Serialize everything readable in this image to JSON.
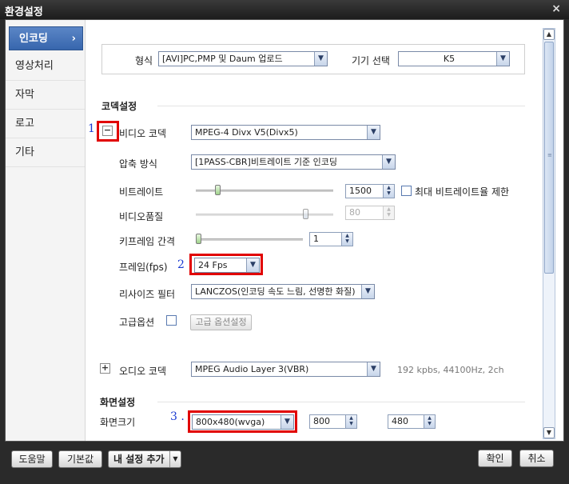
{
  "window": {
    "title": "환경설정",
    "close_glyph": "×"
  },
  "sidebar": {
    "items": [
      {
        "label": "인코딩",
        "arrow": "›"
      },
      {
        "label": "영상처리"
      },
      {
        "label": "자막"
      },
      {
        "label": "로고"
      },
      {
        "label": "기타"
      }
    ]
  },
  "top": {
    "format_label": "형식",
    "format_value": "[AVI]PC,PMP 및 Daum 업로드",
    "device_label": "기기 선택",
    "device_value": "K5"
  },
  "codec": {
    "section_title": "코덱설정",
    "video": {
      "toggle": "−",
      "label": "비디오 코덱",
      "value": "MPEG-4 Divx V5(Divx5)"
    },
    "compression": {
      "label": "압축 방식",
      "value": "[1PASS-CBR]비트레이트 기준 인코딩"
    },
    "bitrate": {
      "label": "비트레이트",
      "value": "1500",
      "limit_label": "최대 비트레이트율 제한",
      "slider_level": 0.15
    },
    "quality": {
      "label": "비디오품질",
      "value": "80",
      "slider_level": 0.8
    },
    "keyframe": {
      "label": "키프레임 간격",
      "value": "1",
      "slider_level": 0.0
    },
    "frame": {
      "label": "프레임(fps)",
      "value": "24 Fps"
    },
    "resize": {
      "label": "리사이즈 필터",
      "value": "LANCZOS(인코딩 속도 느림, 선명한 화질)"
    },
    "advanced": {
      "label": "고급옵션",
      "button": "고급 옵션설정"
    },
    "audio": {
      "toggle": "+",
      "label": "오디오 코덱",
      "value": "MPEG Audio Layer 3(VBR)",
      "info": "192 kpbs, 44100Hz, 2ch"
    }
  },
  "screen": {
    "section_title": "화면설정",
    "size_label": "화면크기",
    "size_value": "800x480(wvga)",
    "width": "800",
    "height": "480"
  },
  "annotations": {
    "n1": "1",
    "n2": "2",
    "n3": "3 ."
  },
  "footer": {
    "help": "도움말",
    "default": "기본값",
    "add_preset": "내 설정 추가",
    "ok": "확인",
    "cancel": "취소"
  },
  "colors": {
    "highlight": "#e10000",
    "annotation_number": "#1a3ad1",
    "active_tab": "#3766ad"
  },
  "icons": {
    "close": "close-icon",
    "dropdown": "chevron-down-icon",
    "spinner": "spinner-arrows-icon",
    "scroll_up": "scroll-up-icon",
    "scroll_down": "scroll-down-icon"
  }
}
